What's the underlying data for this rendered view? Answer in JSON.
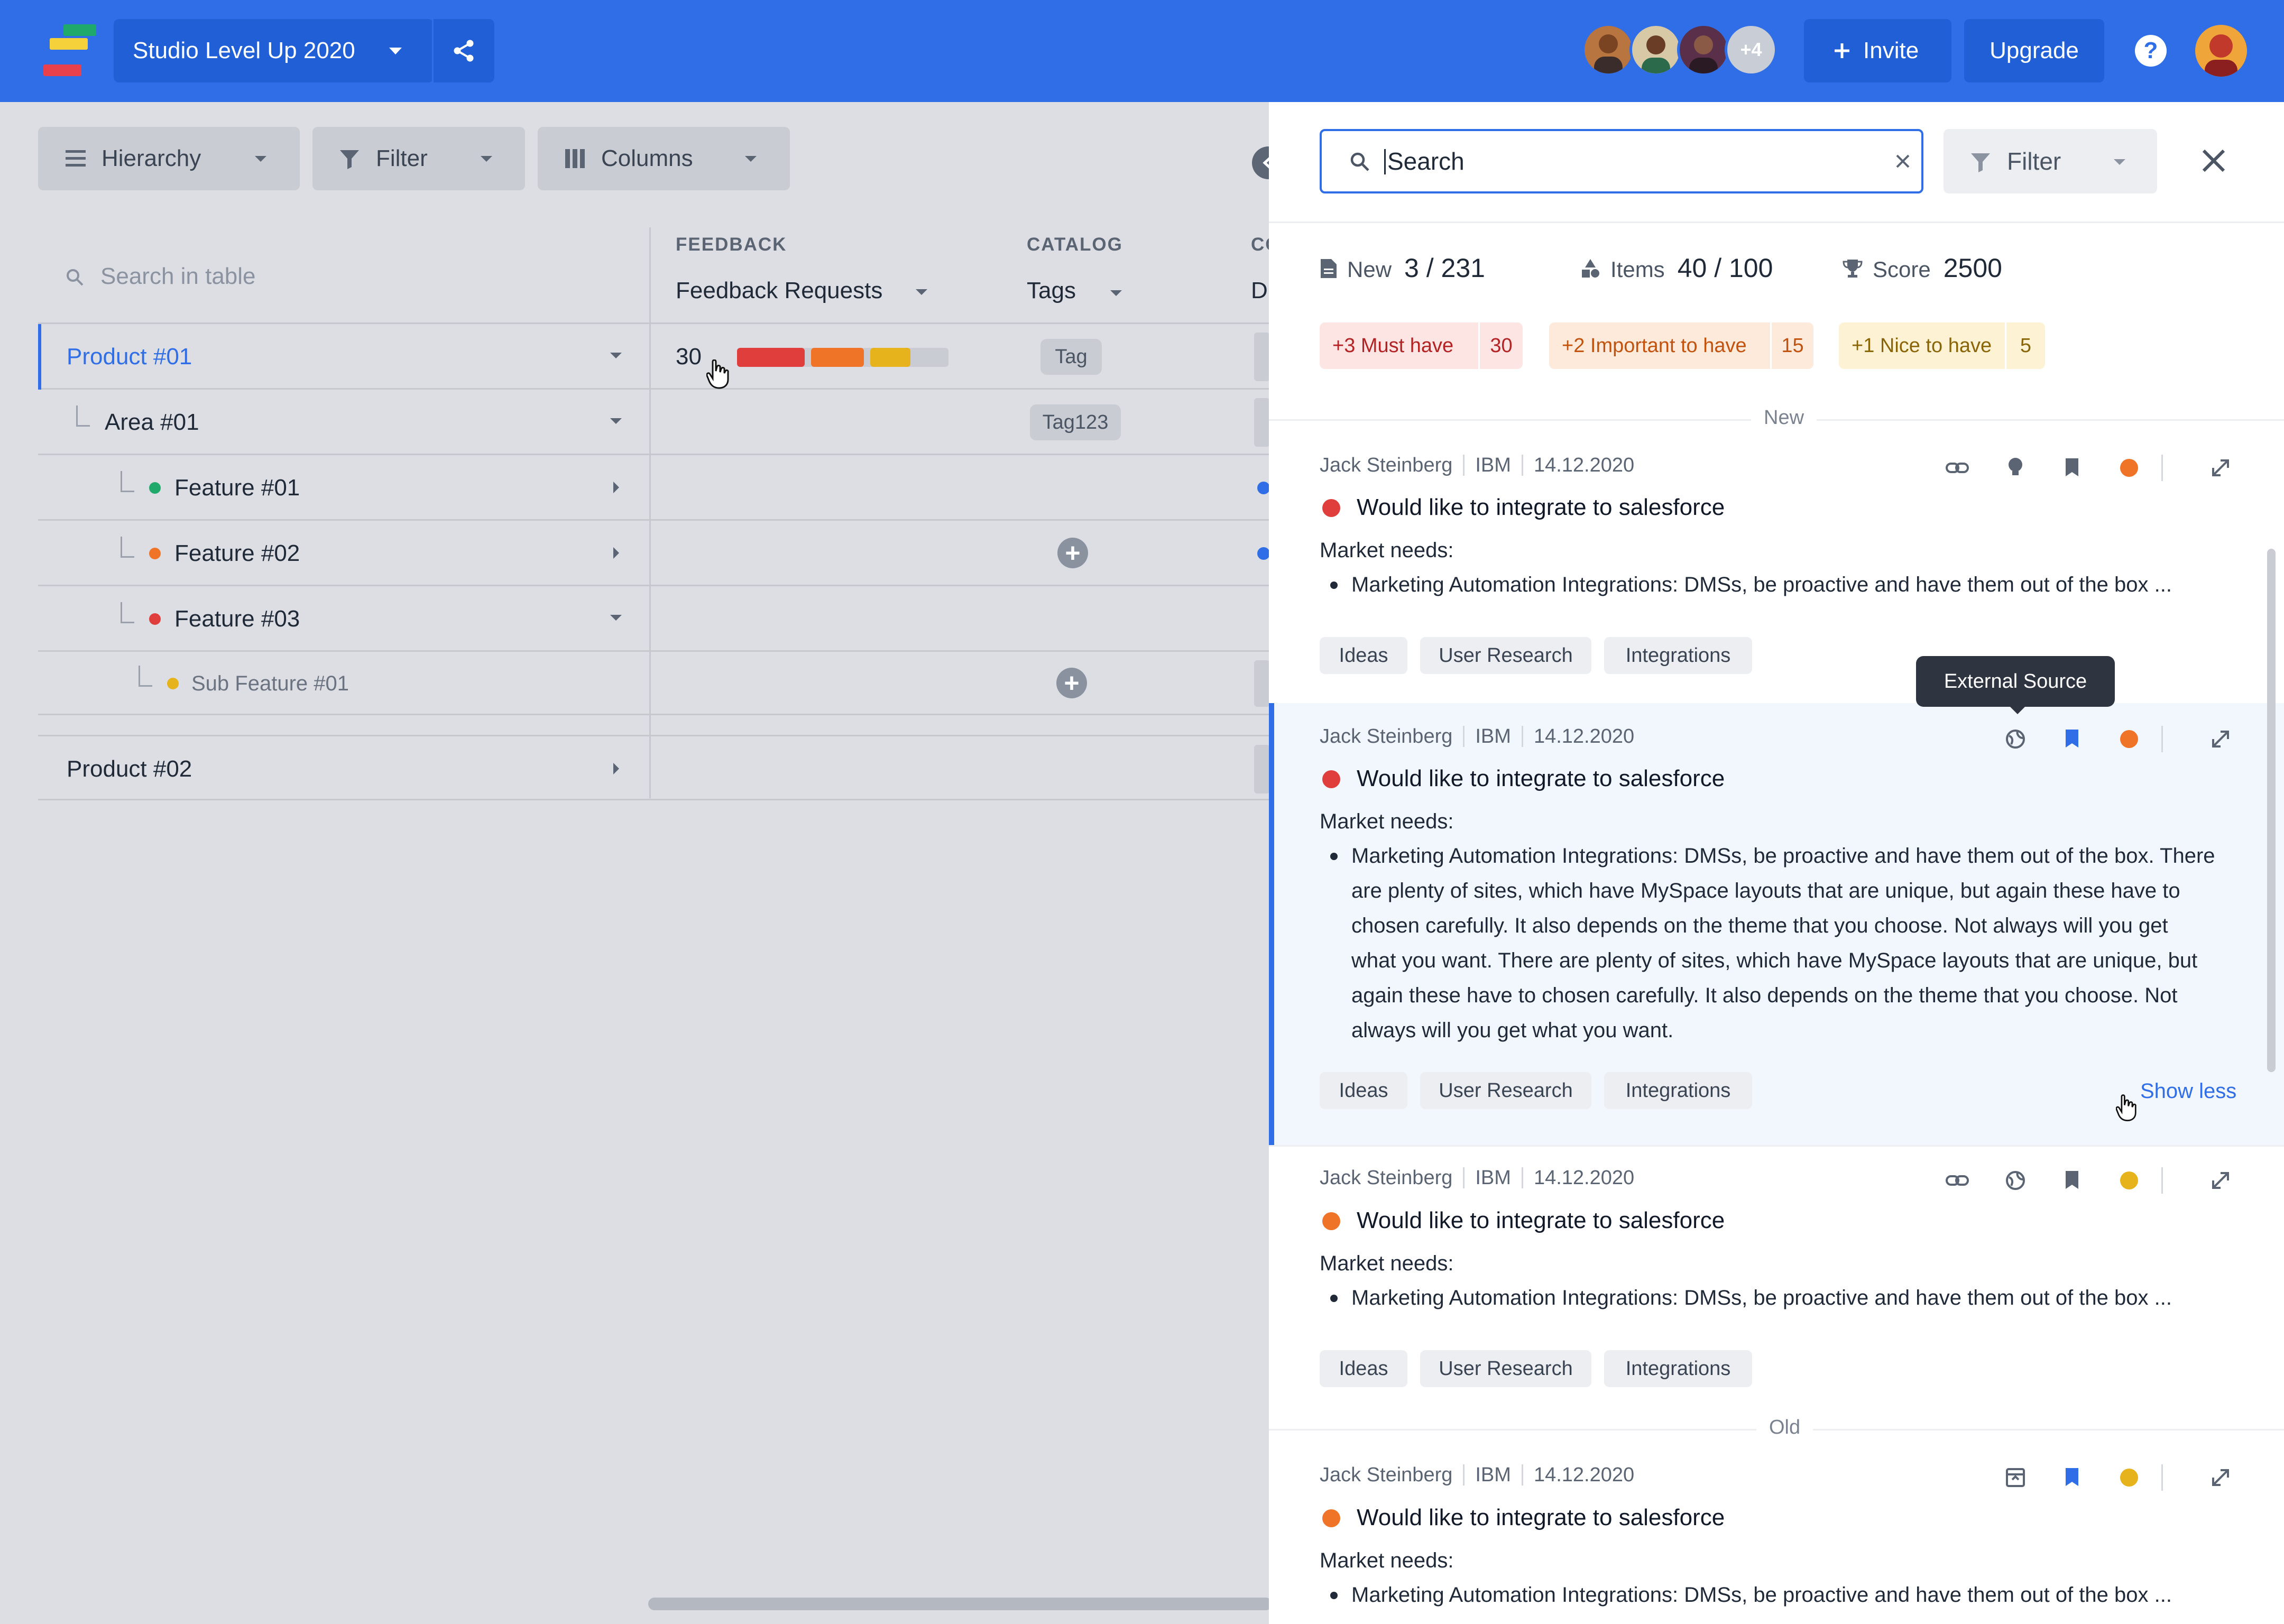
{
  "app": {
    "project_name": "Studio Level Up 2020",
    "avatars_more": "+4",
    "invite_label": "Invite",
    "upgrade_label": "Upgrade",
    "help_label": "?"
  },
  "toolbar": {
    "hierarchy_label": "Hierarchy",
    "filter_label": "Filter",
    "columns_label": "Columns"
  },
  "table": {
    "search_placeholder": "Search in table",
    "groups": [
      "FEEDBACK",
      "CATALOG",
      "CO"
    ],
    "columns": [
      "Feedback Requests",
      "Tags",
      "D"
    ],
    "rows": [
      {
        "label": "Product #01",
        "count": "30",
        "tag": "Tag"
      },
      {
        "label": "Area #01",
        "tag": "Tag123"
      },
      {
        "label": "Feature #01"
      },
      {
        "label": "Feature #02"
      },
      {
        "label": "Feature #03"
      },
      {
        "label": "Sub Feature #01"
      },
      {
        "label": "Product #02"
      }
    ],
    "request_bar": {
      "must": 0.32,
      "important": 0.25,
      "nice": 0.19
    }
  },
  "panel": {
    "search_value": "Search",
    "filter_label": "Filter",
    "stats": {
      "new_label": "New",
      "new_value": "3 / 231",
      "items_label": "Items",
      "items_value": "40 / 100",
      "score_label": "Score",
      "score_value": "2500"
    },
    "priorities": [
      {
        "label": "+3 Must have",
        "count": "30"
      },
      {
        "label": "+2 Important to have",
        "count": "15"
      },
      {
        "label": "+1 Nice to have",
        "count": "5"
      }
    ],
    "section_new": "New",
    "section_old": "Old",
    "tooltip": "External Source",
    "show_less": "Show less",
    "cards": [
      {
        "author": "Jack Steinberg",
        "company": "IBM",
        "date": "14.12.2020",
        "title": "Would like to integrate to salesforce",
        "need_label": "Market needs:",
        "body": "Marketing Automation Integrations: DMSs, be proactive and have them out of the box ...",
        "tags": [
          "Ideas",
          "User Research",
          "Integrations"
        ]
      },
      {
        "author": "Jack Steinberg",
        "company": "IBM",
        "date": "14.12.2020",
        "title": "Would like to integrate to salesforce",
        "need_label": "Market needs:",
        "body": "Marketing Automation Integrations: DMSs, be proactive and have them out of the box. There are plenty of sites, which have MySpace layouts that are unique, but again these have to chosen carefully. It also depends on the theme that you choose. Not always will you get what you want. There are plenty of sites, which have MySpace layouts that are unique, but again these have to chosen carefully. It also depends on the theme that you choose. Not always will you get what you want.",
        "tags": [
          "Ideas",
          "User Research",
          "Integrations"
        ]
      },
      {
        "author": "Jack Steinberg",
        "company": "IBM",
        "date": "14.12.2020",
        "title": "Would like to integrate to salesforce",
        "need_label": "Market needs:",
        "body": "Marketing Automation Integrations: DMSs, be proactive and have them out of the box ...",
        "tags": [
          "Ideas",
          "User Research",
          "Integrations"
        ]
      },
      {
        "author": "Jack Steinberg",
        "company": "IBM",
        "date": "14.12.2020",
        "title": "Would like to integrate to salesforce",
        "need_label": "Market needs:",
        "body": "Marketing Automation Integrations: DMSs, be proactive and have them out of the box ..."
      }
    ]
  },
  "colors": {
    "brand": "#2f6ee6",
    "must": "#e03d3d",
    "important": "#f07428",
    "nice": "#e6b31c",
    "green": "#1faa6b",
    "blue": "#2f6ee6"
  }
}
